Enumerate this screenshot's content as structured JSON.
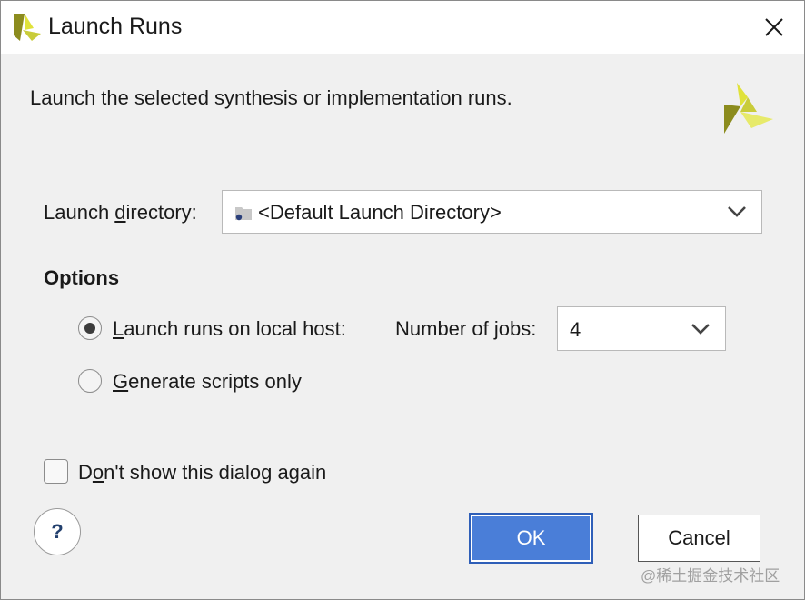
{
  "window": {
    "title": "Launch Runs",
    "close_icon": "close-icon",
    "logo_icon": "vivado-logo-icon"
  },
  "description": "Launch the selected synthesis or implementation runs.",
  "launch_directory": {
    "label_prefix": "Launch ",
    "label_mnemonic": "d",
    "label_suffix": "irectory:",
    "value": "<Default Launch Directory>",
    "folder_icon": "folder-icon"
  },
  "options": {
    "heading": "Options",
    "local_host": {
      "mnemonic": "L",
      "label_rest": "aunch runs on local host:",
      "checked": true
    },
    "jobs": {
      "label_prefix": "Number of ",
      "label_mnemonic": "j",
      "label_suffix": "obs:",
      "value": "4"
    },
    "scripts_only": {
      "mnemonic": "G",
      "label_rest": "enerate scripts only",
      "checked": false
    }
  },
  "dont_show": {
    "prefix": "D",
    "mnemonic": "o",
    "rest": "n't show this dialog again",
    "checked": false
  },
  "buttons": {
    "help": "?",
    "ok": "OK",
    "cancel": "Cancel"
  },
  "watermark": "@稀土掘金技术社区",
  "colors": {
    "ok_button": "#4a7ed8",
    "logo_yellow": "#e0e23a",
    "logo_olive": "#8c8c1e"
  }
}
